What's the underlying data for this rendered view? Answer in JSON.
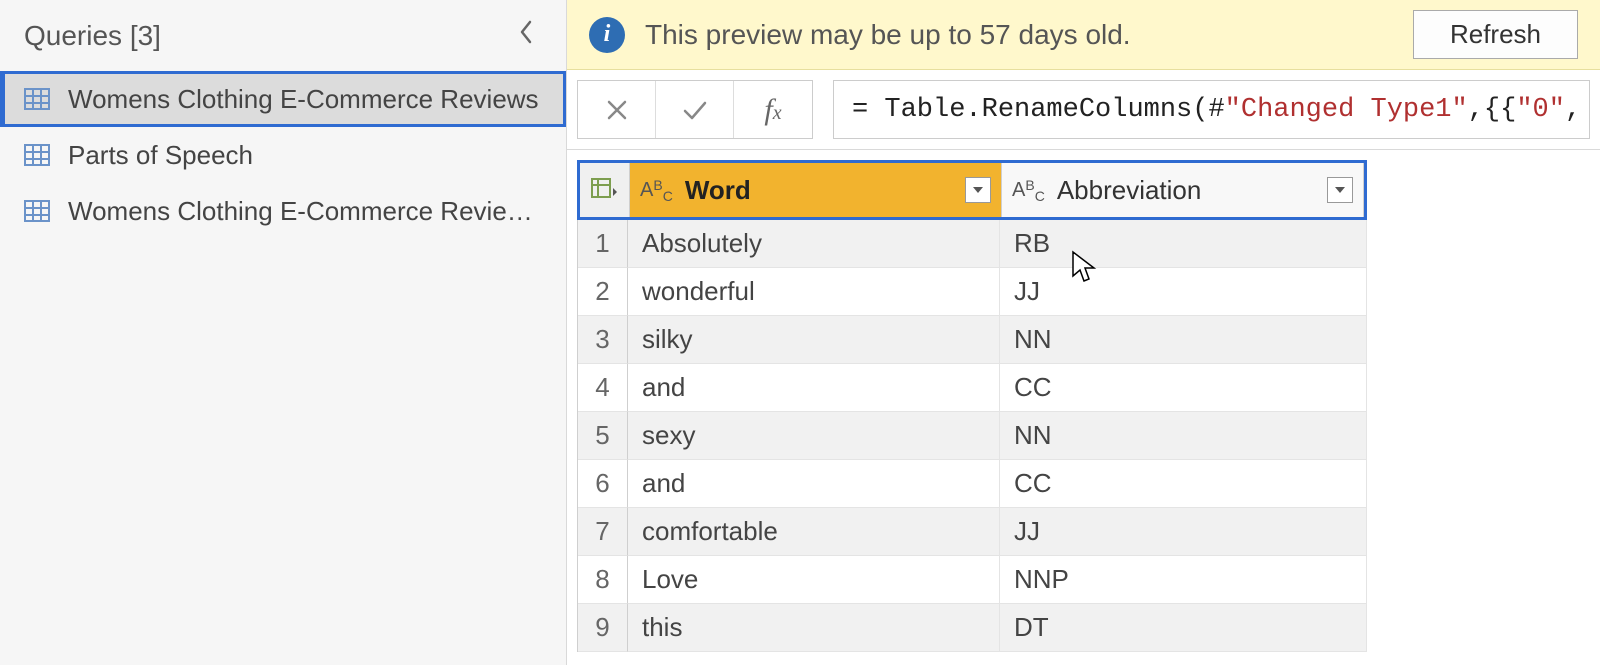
{
  "sidebar": {
    "title": "Queries [3]",
    "items": [
      {
        "label": "Womens Clothing E-Commerce Reviews",
        "selected": true
      },
      {
        "label": "Parts of Speech",
        "selected": false
      },
      {
        "label": "Womens Clothing E-Commerce Review...",
        "selected": false
      }
    ]
  },
  "info_bar": {
    "text": "This preview may be up to 57 days old.",
    "refresh_label": "Refresh"
  },
  "formula_bar": {
    "prefix": "= Table.RenameColumns(#",
    "str1": "\"Changed Type1\"",
    "mid": ",{{",
    "str2": "\"0\"",
    "suffix": ", "
  },
  "columns": {
    "word": "Word",
    "abbr": "Abbreviation"
  },
  "rows": [
    {
      "n": "1",
      "word": "Absolutely",
      "abbr": "RB"
    },
    {
      "n": "2",
      "word": "wonderful",
      "abbr": "JJ"
    },
    {
      "n": "3",
      "word": "silky",
      "abbr": "NN"
    },
    {
      "n": "4",
      "word": "and",
      "abbr": "CC"
    },
    {
      "n": "5",
      "word": "sexy",
      "abbr": "NN"
    },
    {
      "n": "6",
      "word": "and",
      "abbr": "CC"
    },
    {
      "n": "7",
      "word": "comfortable",
      "abbr": "JJ"
    },
    {
      "n": "8",
      "word": "Love",
      "abbr": "NNP"
    },
    {
      "n": "9",
      "word": "this",
      "abbr": "DT"
    }
  ]
}
